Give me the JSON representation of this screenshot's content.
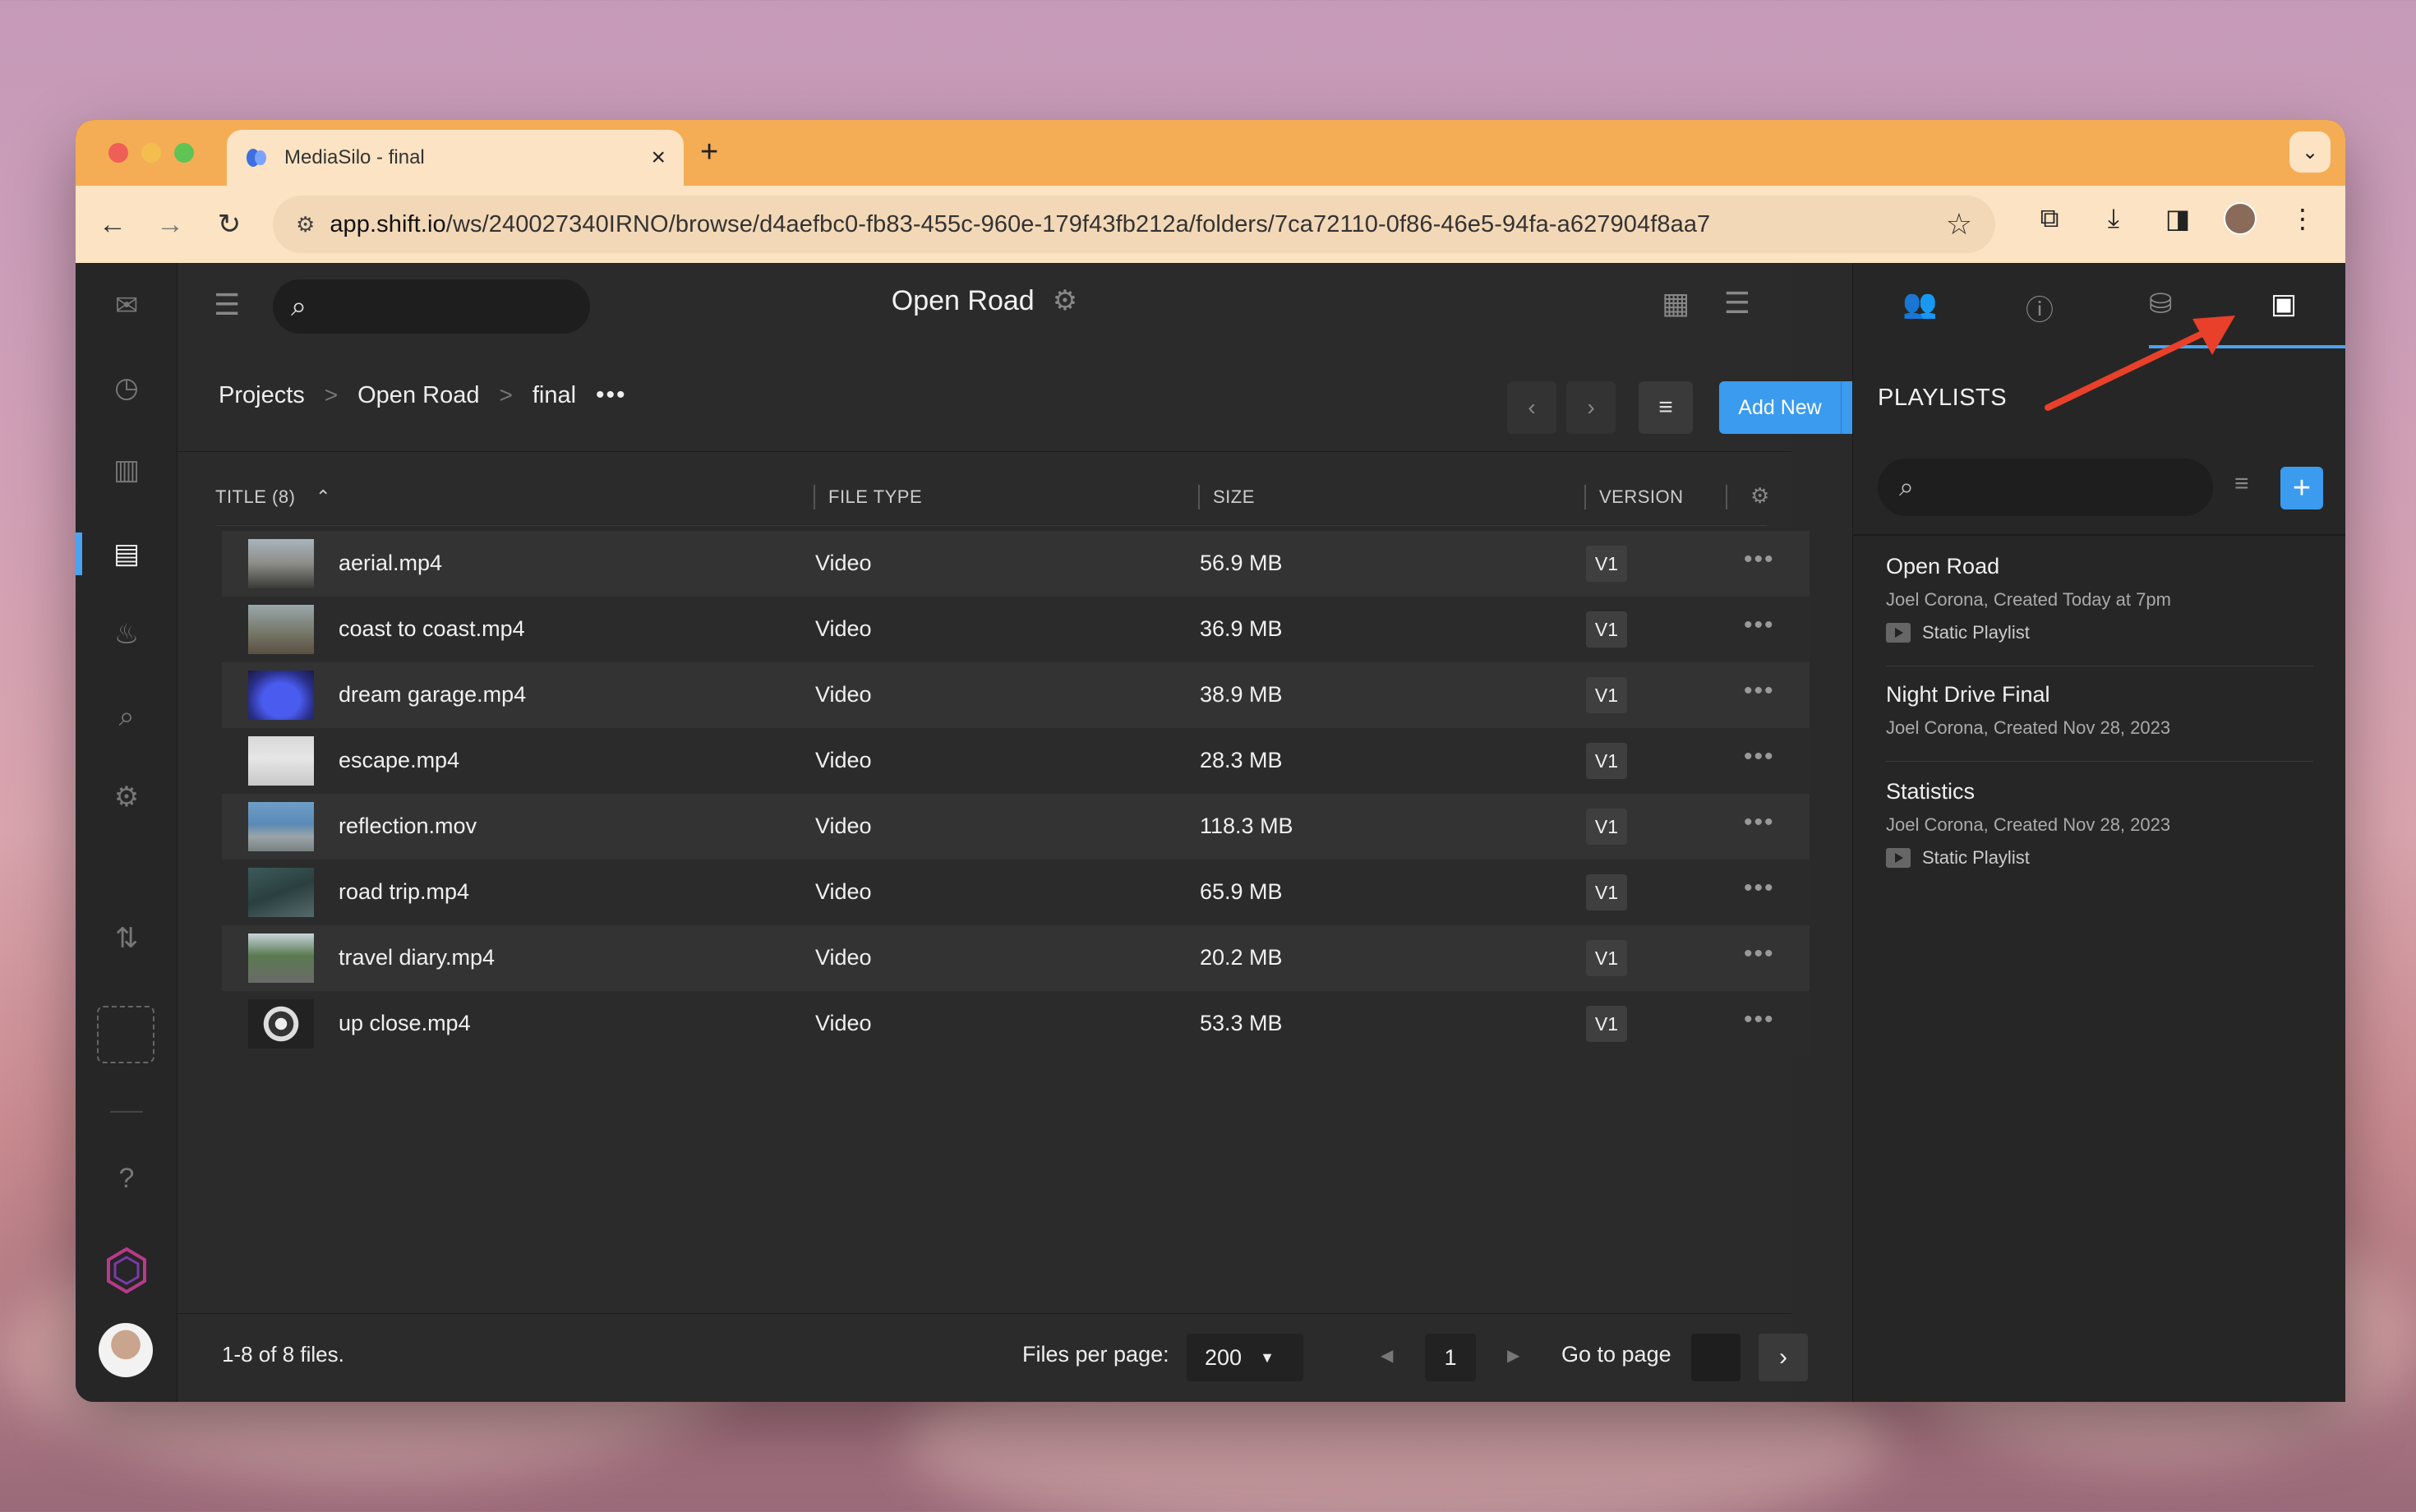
{
  "browser": {
    "tab_title": "MediaSilo - final",
    "url_host": "app.shift.io",
    "url_path": "/ws/240027340IRNO/browse/d4aefbc0-fb83-455c-960e-179f43fb212a/folders/7ca72110-0f86-46e5-94fa-a627904f8aa7"
  },
  "header": {
    "title": "Open Road"
  },
  "breadcrumb": {
    "items": [
      "Projects",
      "Open Road",
      "final"
    ],
    "separator": ">"
  },
  "toolbar": {
    "add_new_label": "Add New"
  },
  "table": {
    "columns": {
      "title": "TITLE (8)",
      "file_type": "FILE TYPE",
      "size": "SIZE",
      "version": "VERSION"
    },
    "rows": [
      {
        "name": "aerial.mp4",
        "type": "Video",
        "size": "56.9 MB",
        "version": "V1"
      },
      {
        "name": "coast to coast.mp4",
        "type": "Video",
        "size": "36.9 MB",
        "version": "V1"
      },
      {
        "name": "dream garage.mp4",
        "type": "Video",
        "size": "38.9 MB",
        "version": "V1"
      },
      {
        "name": "escape.mp4",
        "type": "Video",
        "size": "28.3 MB",
        "version": "V1"
      },
      {
        "name": "reflection.mov",
        "type": "Video",
        "size": "118.3 MB",
        "version": "V1"
      },
      {
        "name": "road trip.mp4",
        "type": "Video",
        "size": "65.9 MB",
        "version": "V1"
      },
      {
        "name": "travel diary.mp4",
        "type": "Video",
        "size": "20.2 MB",
        "version": "V1"
      },
      {
        "name": "up close.mp4",
        "type": "Video",
        "size": "53.3 MB",
        "version": "V1"
      }
    ]
  },
  "footer": {
    "count_text": "1-8 of 8 files.",
    "per_page_label": "Files per page:",
    "per_page_value": "200",
    "current_page": "1",
    "goto_label": "Go to page"
  },
  "right_panel": {
    "heading": "PLAYLISTS",
    "playlists": [
      {
        "name": "Open Road",
        "meta": "Joel Corona, Created Today at 7pm",
        "type": "Static Playlist"
      },
      {
        "name": "Night Drive Final",
        "meta": "Joel Corona, Created Nov 28, 2023",
        "type": ""
      },
      {
        "name": "Statistics",
        "meta": "Joel Corona, Created Nov 28, 2023",
        "type": "Static Playlist"
      }
    ]
  },
  "icons": {
    "left_nav": [
      "inbox-icon",
      "clock-icon",
      "chart-icon",
      "library-icon",
      "fire-icon",
      "search-icon",
      "gear-icon",
      "transfer-icon",
      "help-icon"
    ],
    "right_tabs": [
      "users-icon",
      "info-icon",
      "database-icon",
      "playlist-icon"
    ]
  },
  "colors": {
    "accent": "#3b9bef",
    "tabbar": "#f4ad55",
    "annotation_arrow": "#e8402a"
  }
}
